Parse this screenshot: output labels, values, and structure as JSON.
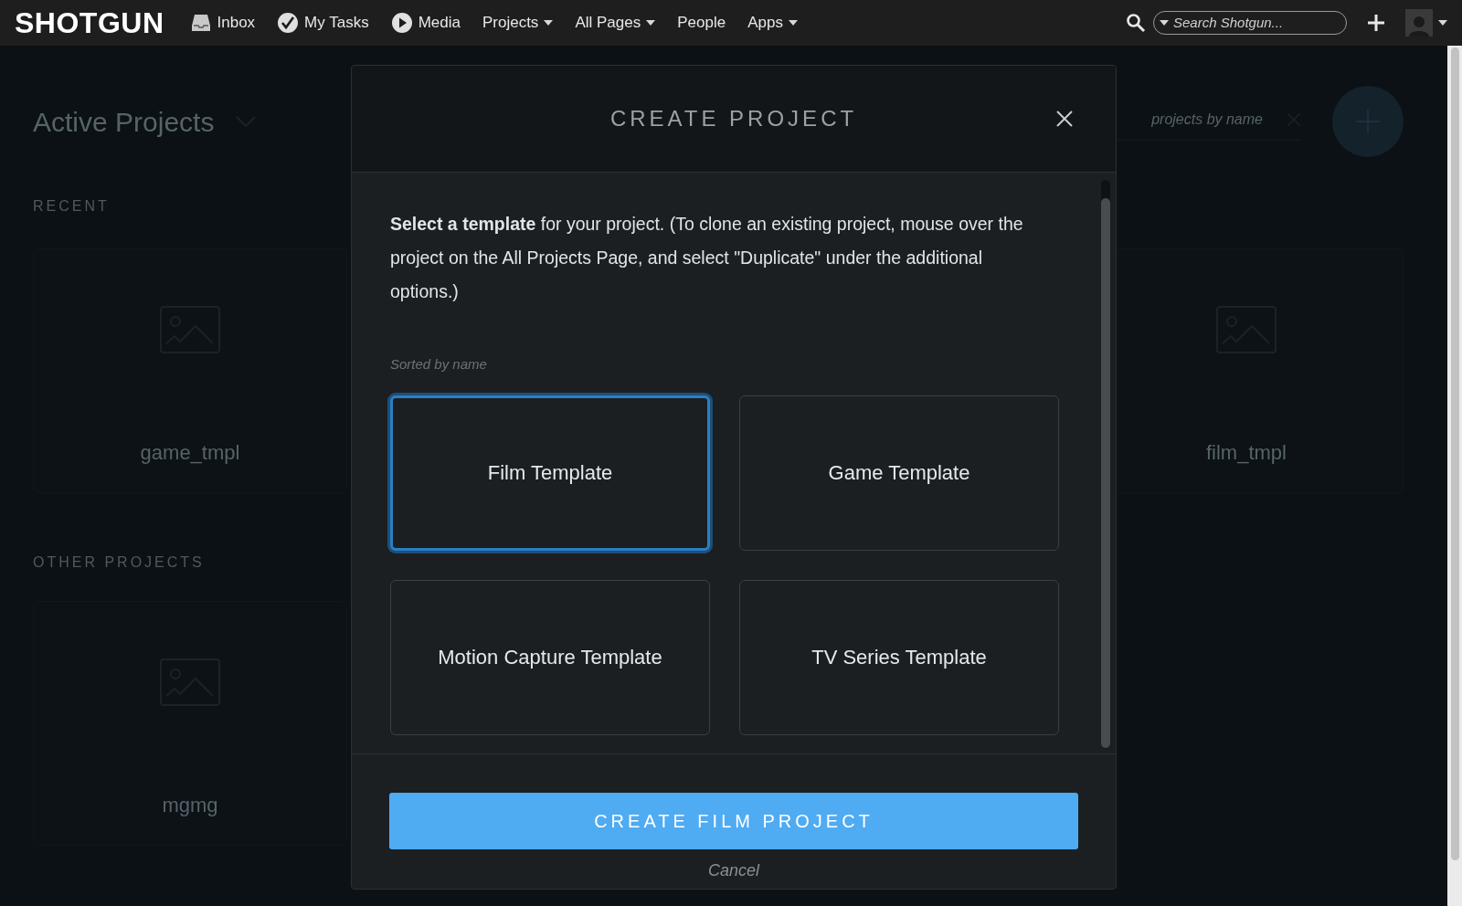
{
  "nav": {
    "logo": "SHOTGUN",
    "items": [
      {
        "label": "Inbox",
        "kind": "inbox",
        "dropdown": false
      },
      {
        "label": "My Tasks",
        "kind": "tasks",
        "dropdown": false
      },
      {
        "label": "Media",
        "kind": "media",
        "dropdown": false
      },
      {
        "label": "Projects",
        "kind": "menu",
        "dropdown": true
      },
      {
        "label": "All Pages",
        "kind": "menu",
        "dropdown": true
      },
      {
        "label": "People",
        "kind": "menu",
        "dropdown": false
      },
      {
        "label": "Apps",
        "kind": "menu",
        "dropdown": true
      }
    ],
    "search": {
      "placeholder": "Search Shotgun..."
    }
  },
  "background": {
    "title": "Active Projects",
    "search_placeholder": "projects by name",
    "sections": [
      {
        "heading": "RECENT",
        "projects": [
          {
            "name": "game_tmpl"
          },
          {
            "name": "film_tmpl"
          }
        ]
      },
      {
        "heading": "OTHER PROJECTS",
        "projects": [
          {
            "name": "mgmg"
          }
        ]
      }
    ]
  },
  "dialog": {
    "title": "CREATE PROJECT",
    "intro": "**Select a template** for your project. (To clone an existing project, mouse over the project on the All Projects Page, and select \"Duplicate\" under the additional options.)",
    "sort_note": "Sorted by name",
    "templates": [
      {
        "label": "Film Template",
        "selected": true
      },
      {
        "label": "Game Template",
        "selected": false
      },
      {
        "label": "Motion Capture Template",
        "selected": false
      },
      {
        "label": "TV Series Template",
        "selected": false
      }
    ],
    "primary_button": "CREATE FILM PROJECT",
    "cancel": "Cancel"
  }
}
